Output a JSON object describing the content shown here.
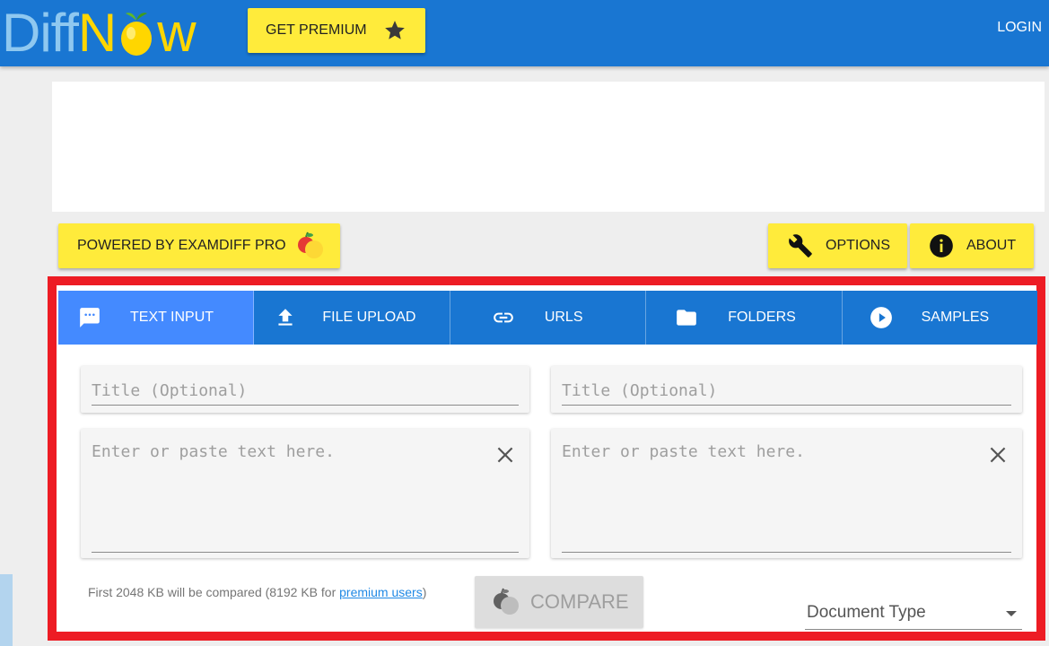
{
  "header": {
    "logo_text_1": "Diff",
    "logo_text_2": "N",
    "logo_text_3": "w",
    "premium_label": "GET PREMIUM",
    "login_label": "LOGIN"
  },
  "toolbar": {
    "powered_label": "POWERED BY EXAMDIFF PRO",
    "options_label": "OPTIONS",
    "about_label": "ABOUT"
  },
  "tabs": [
    {
      "label": "TEXT INPUT",
      "icon": "chat-bubble-icon",
      "active": true
    },
    {
      "label": "FILE UPLOAD",
      "icon": "upload-icon",
      "active": false
    },
    {
      "label": "URLS",
      "icon": "link-icon",
      "active": false
    },
    {
      "label": "FOLDERS",
      "icon": "folder-icon",
      "active": false
    },
    {
      "label": "SAMPLES",
      "icon": "play-circle-icon",
      "active": false
    }
  ],
  "left": {
    "title_placeholder": "Title (Optional)",
    "text_placeholder": "Enter or paste text here."
  },
  "right": {
    "title_placeholder": "Title (Optional)",
    "text_placeholder": "Enter or paste text here."
  },
  "footer": {
    "note_prefix": "First 2048 KB will be compared (8192 KB for ",
    "note_link": "premium users",
    "note_suffix": ")",
    "compare_label": "COMPARE",
    "doc_type_label": "Document Type"
  },
  "colors": {
    "header_blue": "#1976d2",
    "active_tab": "#448aff",
    "button_yellow": "#ffeb3b",
    "frame_red": "#ed1c24"
  }
}
